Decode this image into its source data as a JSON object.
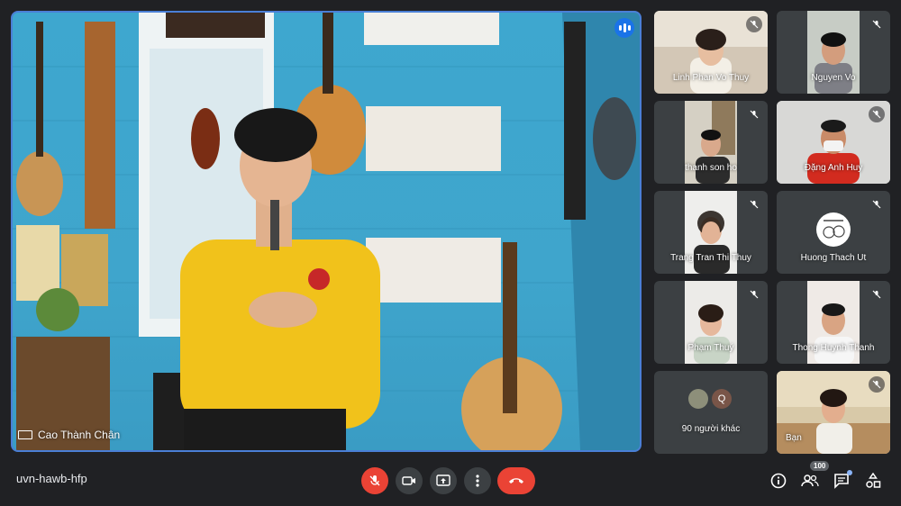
{
  "main_speaker": {
    "name": "Cao Thành Chân"
  },
  "participants": [
    {
      "name": "Linh Phan Vo Thuy",
      "muted": true
    },
    {
      "name": "Nguyen Vo",
      "muted": true
    },
    {
      "name": "thanh son ho",
      "muted": true
    },
    {
      "name": "Đặng Anh Huy",
      "muted": true
    },
    {
      "name": "Trang Tran Thi Thuy",
      "muted": true
    },
    {
      "name": "Huong Thach Ut",
      "muted": true
    },
    {
      "name": "Phạm Thuý",
      "muted": true
    },
    {
      "name": "Thong Huynh Thanh",
      "muted": true
    },
    {
      "name": "Bạn",
      "muted": true
    }
  ],
  "others": {
    "label": "90 người khác",
    "avatar_initial": "Q"
  },
  "bottom_bar": {
    "meeting_code": "uvn-hawb-hfp",
    "people_count": "100"
  },
  "colors": {
    "accent": "#1a73e8",
    "danger": "#ea4335",
    "bar_bg": "#202124"
  }
}
